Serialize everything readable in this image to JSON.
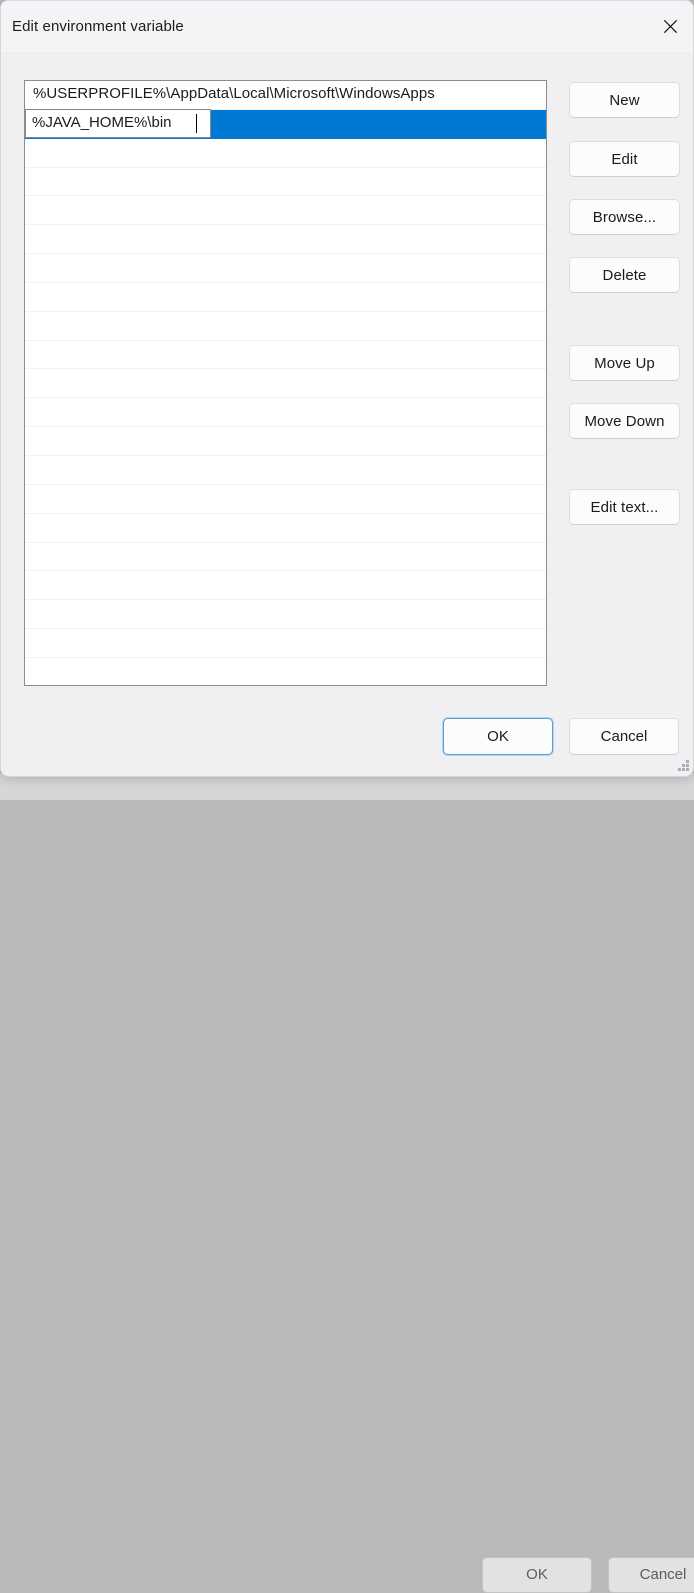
{
  "window": {
    "title": "Edit environment variable",
    "close_icon": "close-icon"
  },
  "list": {
    "rows": [
      {
        "text": "%USERPROFILE%\\AppData\\Local\\Microsoft\\WindowsApps",
        "selected": false,
        "editing": false
      },
      {
        "text": "%JAVA_HOME%\\bin",
        "selected": true,
        "editing": true
      },
      {
        "text": "",
        "selected": false,
        "editing": false
      },
      {
        "text": "",
        "selected": false,
        "editing": false
      },
      {
        "text": "",
        "selected": false,
        "editing": false
      },
      {
        "text": "",
        "selected": false,
        "editing": false
      },
      {
        "text": "",
        "selected": false,
        "editing": false
      },
      {
        "text": "",
        "selected": false,
        "editing": false
      },
      {
        "text": "",
        "selected": false,
        "editing": false
      },
      {
        "text": "",
        "selected": false,
        "editing": false
      },
      {
        "text": "",
        "selected": false,
        "editing": false
      },
      {
        "text": "",
        "selected": false,
        "editing": false
      },
      {
        "text": "",
        "selected": false,
        "editing": false
      },
      {
        "text": "",
        "selected": false,
        "editing": false
      },
      {
        "text": "",
        "selected": false,
        "editing": false
      },
      {
        "text": "",
        "selected": false,
        "editing": false
      },
      {
        "text": "",
        "selected": false,
        "editing": false
      },
      {
        "text": "",
        "selected": false,
        "editing": false
      },
      {
        "text": "",
        "selected": false,
        "editing": false
      },
      {
        "text": "",
        "selected": false,
        "editing": false
      },
      {
        "text": "",
        "selected": false,
        "editing": false
      }
    ],
    "editing_value": "%JAVA_HOME%\\bin",
    "selection_color": "#0078d4"
  },
  "side_buttons": {
    "new": "New",
    "edit": "Edit",
    "browse": "Browse...",
    "delete": "Delete",
    "move_up": "Move Up",
    "move_down": "Move Down",
    "edit_text": "Edit text..."
  },
  "footer": {
    "ok": "OK",
    "cancel": "Cancel",
    "focus_color": "#5a9fd4"
  },
  "background_window": {
    "ok": "OK",
    "cancel": "Cancel"
  }
}
